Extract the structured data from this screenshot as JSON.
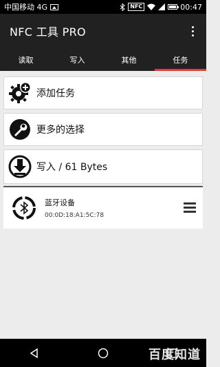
{
  "status_bar": {
    "carrier": "中国移动 4G",
    "nfc": "NFC",
    "time": "00:47"
  },
  "app": {
    "title": "NFC 工具 PRO"
  },
  "tabs": [
    {
      "label": "读取"
    },
    {
      "label": "写入"
    },
    {
      "label": "其他"
    },
    {
      "label": "任务"
    }
  ],
  "cards": {
    "add_task": "添加任务",
    "more_choices": "更多的选择",
    "write": "写入 / 61 Bytes"
  },
  "task": {
    "name": "蓝牙设备",
    "mac": "00:0D:18:A1:5C:78"
  },
  "watermark": "百度知道",
  "colors": {
    "accent": "#e53935",
    "bar": "#212121"
  }
}
